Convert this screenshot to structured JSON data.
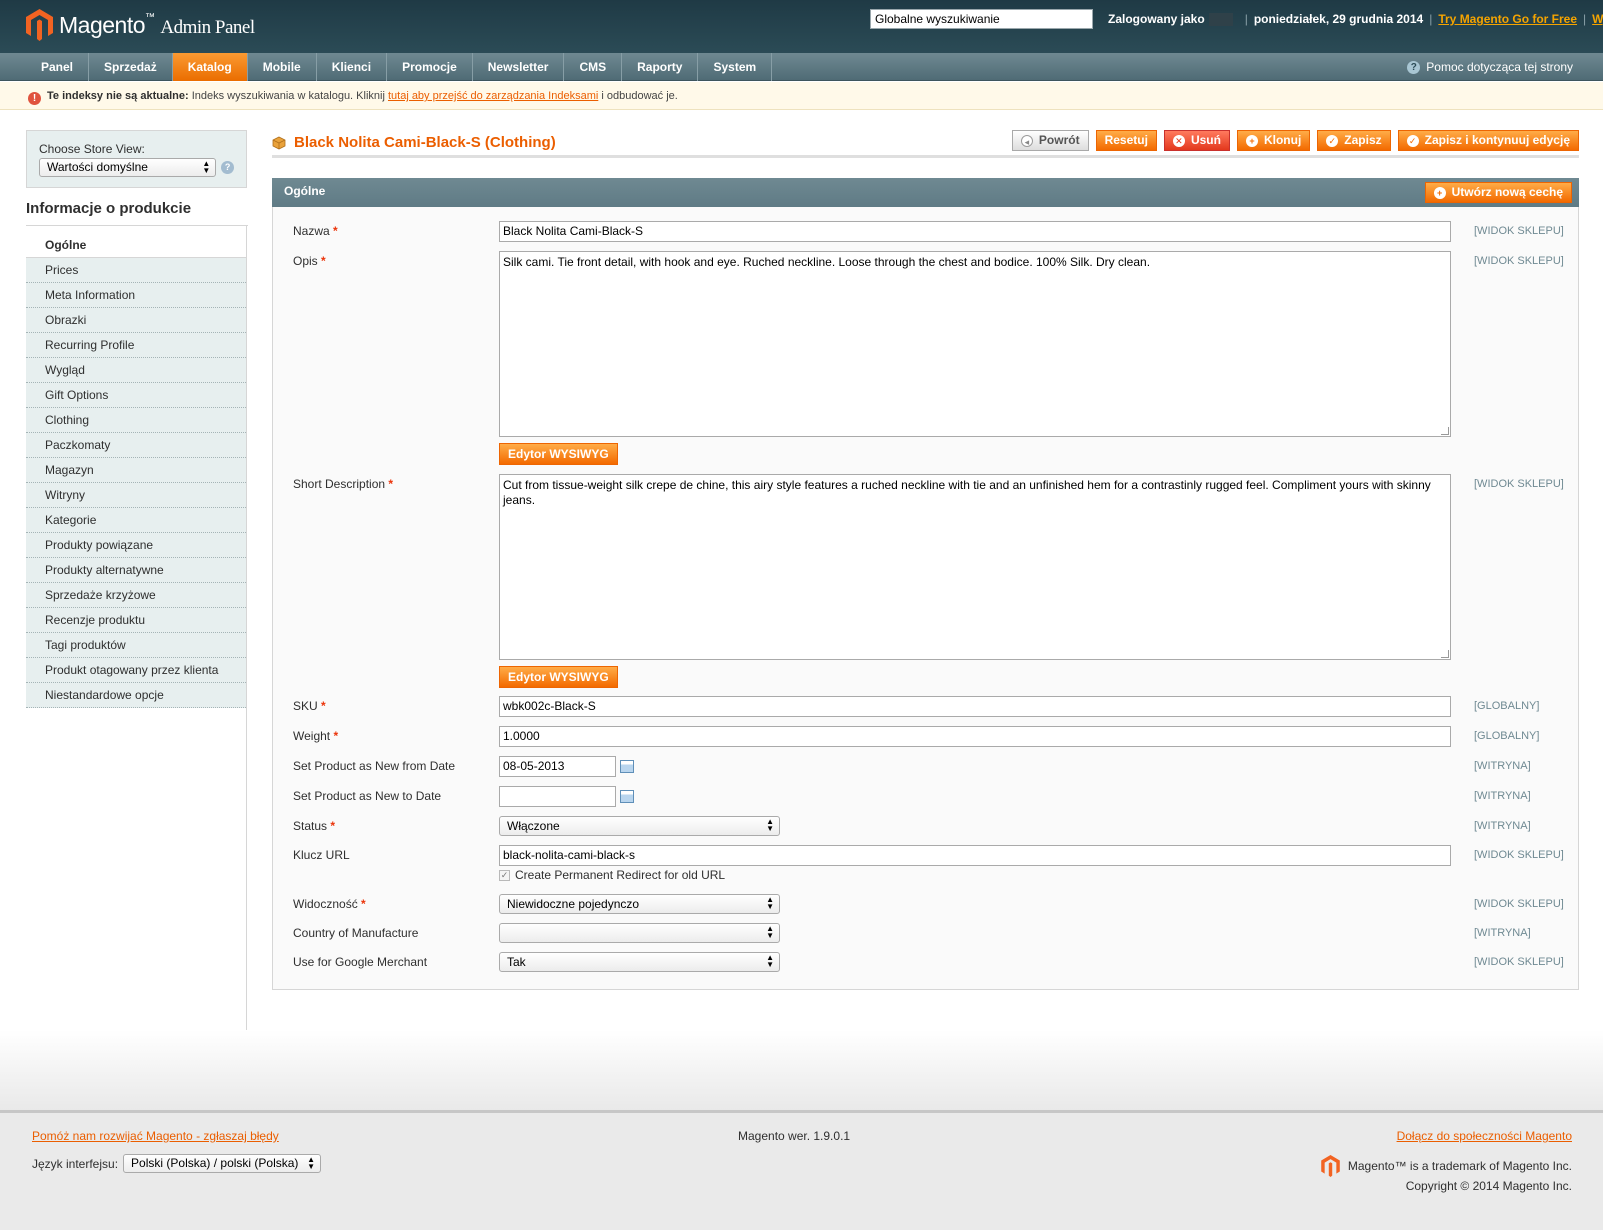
{
  "header": {
    "logo_text": "Magento",
    "logo_tm": "™",
    "logo_sub": "Admin Panel",
    "search_value": "Globalne wyszukiwanie",
    "logged_as_label": "Zalogowany jako",
    "date": "poniedziałek, 29 grudnia 2014",
    "try_link": "Try Magento Go for Free",
    "logout_link": "Wyloguj"
  },
  "nav": {
    "items": [
      "Panel",
      "Sprzedaż",
      "Katalog",
      "Mobile",
      "Klienci",
      "Promocje",
      "Newsletter",
      "CMS",
      "Raporty",
      "System"
    ],
    "active": "Katalog",
    "help": "Pomoc dotycząca tej strony"
  },
  "notice": {
    "bold": "Te indeksy nie są aktualne:",
    "text1": "Indeks wyszukiwania w katalogu. Kliknij",
    "link": "tutaj aby przejść do zarządzania Indeksami",
    "text2": "i odbudować je."
  },
  "sidebar": {
    "store_label": "Choose Store View:",
    "store_value": "Wartości domyślne",
    "title": "Informacje o produkcie",
    "tabs": [
      "Ogólne",
      "Prices",
      "Meta Information",
      "Obrazki",
      "Recurring Profile",
      "Wygląd",
      "Gift Options",
      "Clothing",
      "Paczkomaty",
      "Magazyn",
      "Witryny",
      "Kategorie",
      "Produkty powiązane",
      "Produkty alternatywne",
      "Sprzedaże krzyżowe",
      "Recenzje produktu",
      "Tagi produktów",
      "Produkt otagowany przez klienta",
      "Niestandardowe opcje"
    ],
    "active_tab": "Ogólne"
  },
  "page": {
    "title": "Black Nolita Cami-Black-S (Clothing)",
    "buttons": {
      "back": "Powrót",
      "reset": "Resetuj",
      "delete": "Usuń",
      "clone": "Klonuj",
      "save": "Zapisz",
      "save_continue": "Zapisz i kontynuuj edycję"
    },
    "fieldset_legend": "Ogólne",
    "new_attribute": "Utwórz nową cechę"
  },
  "form": {
    "name": {
      "label": "Nazwa",
      "value": "Black Nolita Cami-Black-S",
      "scope": "[WIDOK SKLEPU]"
    },
    "description": {
      "label": "Opis",
      "value": "Silk cami. Tie front detail, with hook and eye. Ruched neckline. Loose through the chest and bodice. 100% Silk. Dry clean.",
      "scope": "[WIDOK SKLEPU]"
    },
    "wysiwyg_label": "Edytor WYSIWYG",
    "short_description": {
      "label": "Short Description",
      "value": "Cut from tissue-weight silk crepe de chine, this airy style features a ruched neckline with tie and an unfinished hem for a contrastinly rugged feel. Compliment yours with skinny jeans.",
      "scope": "[WIDOK SKLEPU]"
    },
    "sku": {
      "label": "SKU",
      "value": "wbk002c-Black-S",
      "scope": "[GLOBALNY]"
    },
    "weight": {
      "label": "Weight",
      "value": "1.0000",
      "scope": "[GLOBALNY]"
    },
    "new_from": {
      "label": "Set Product as New from Date",
      "value": "08-05-2013",
      "scope": "[WITRYNA]"
    },
    "new_to": {
      "label": "Set Product as New to Date",
      "value": "",
      "scope": "[WITRYNA]"
    },
    "status": {
      "label": "Status",
      "value": "Włączone",
      "scope": "[WITRYNA]"
    },
    "url_key": {
      "label": "Klucz URL",
      "value": "black-nolita-cami-black-s",
      "scope": "[WIDOK SKLEPU]"
    },
    "redirect_label": "Create Permanent Redirect for old URL",
    "visibility": {
      "label": "Widoczność",
      "value": "Niewidoczne pojedynczo",
      "scope": "[WIDOK SKLEPU]"
    },
    "country": {
      "label": "Country of Manufacture",
      "value": "",
      "scope": "[WITRYNA]"
    },
    "google": {
      "label": "Use for Google Merchant",
      "value": "Tak",
      "scope": "[WIDOK SKLEPU]"
    }
  },
  "footer": {
    "bug_link": "Pomóż nam rozwijać Magento - zgłaszaj błędy",
    "lang_label": "Język interfejsu:",
    "lang_value": "Polski (Polska) / polski (Polska)",
    "version": "Magento wer. 1.9.0.1",
    "community_link": "Dołącz do społeczności Magento",
    "trademark": "Magento™ is a trademark of Magento Inc.",
    "copyright": "Copyright © 2014 Magento Inc."
  },
  "colors": {
    "header": "#1f3a45",
    "nav": "#5f7b85",
    "accent": "#eb5e00",
    "button": "#f36a00",
    "delete": "#e3381d"
  }
}
